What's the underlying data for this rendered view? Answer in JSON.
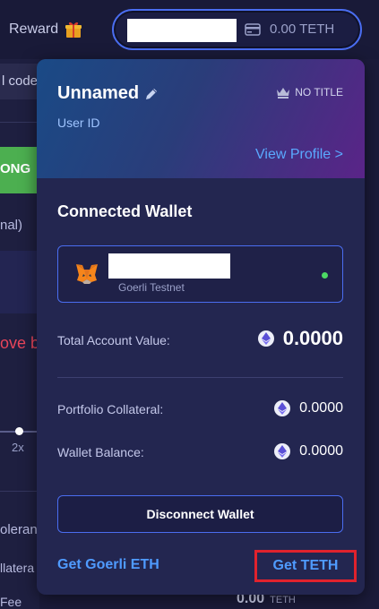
{
  "header": {
    "reward_label": "Reward",
    "balance": "0.00 TETH"
  },
  "background": {
    "code_label": "l code",
    "long_label": "ONG",
    "nal_label": "nal)",
    "red_text": "ove b",
    "leverage": "2x",
    "tolerance": "oleran",
    "collateral": "llatera",
    "fee": "Fee",
    "fee_value": "0.00",
    "fee_unit": "TETH"
  },
  "profile": {
    "name": "Unnamed",
    "title_badge": "NO TITLE",
    "user_id_label": "User ID",
    "view_profile": "View Profile >"
  },
  "wallet": {
    "section_title": "Connected Wallet",
    "network": "Goerli Testnet",
    "status_color": "#4cd964",
    "total_label": "Total Account Value:",
    "total_value": "0.0000",
    "portfolio_label": "Portfolio Collateral:",
    "portfolio_value": "0.0000",
    "balance_label": "Wallet Balance:",
    "balance_value": "0.0000",
    "disconnect_label": "Disconnect Wallet",
    "get_goerli": "Get Goerli ETH",
    "get_teth": "Get TETH"
  },
  "colors": {
    "accent_blue": "#4a6df0",
    "link_blue": "#4f9bff",
    "highlight_red": "#e0222d",
    "long_green": "#4caf50"
  }
}
